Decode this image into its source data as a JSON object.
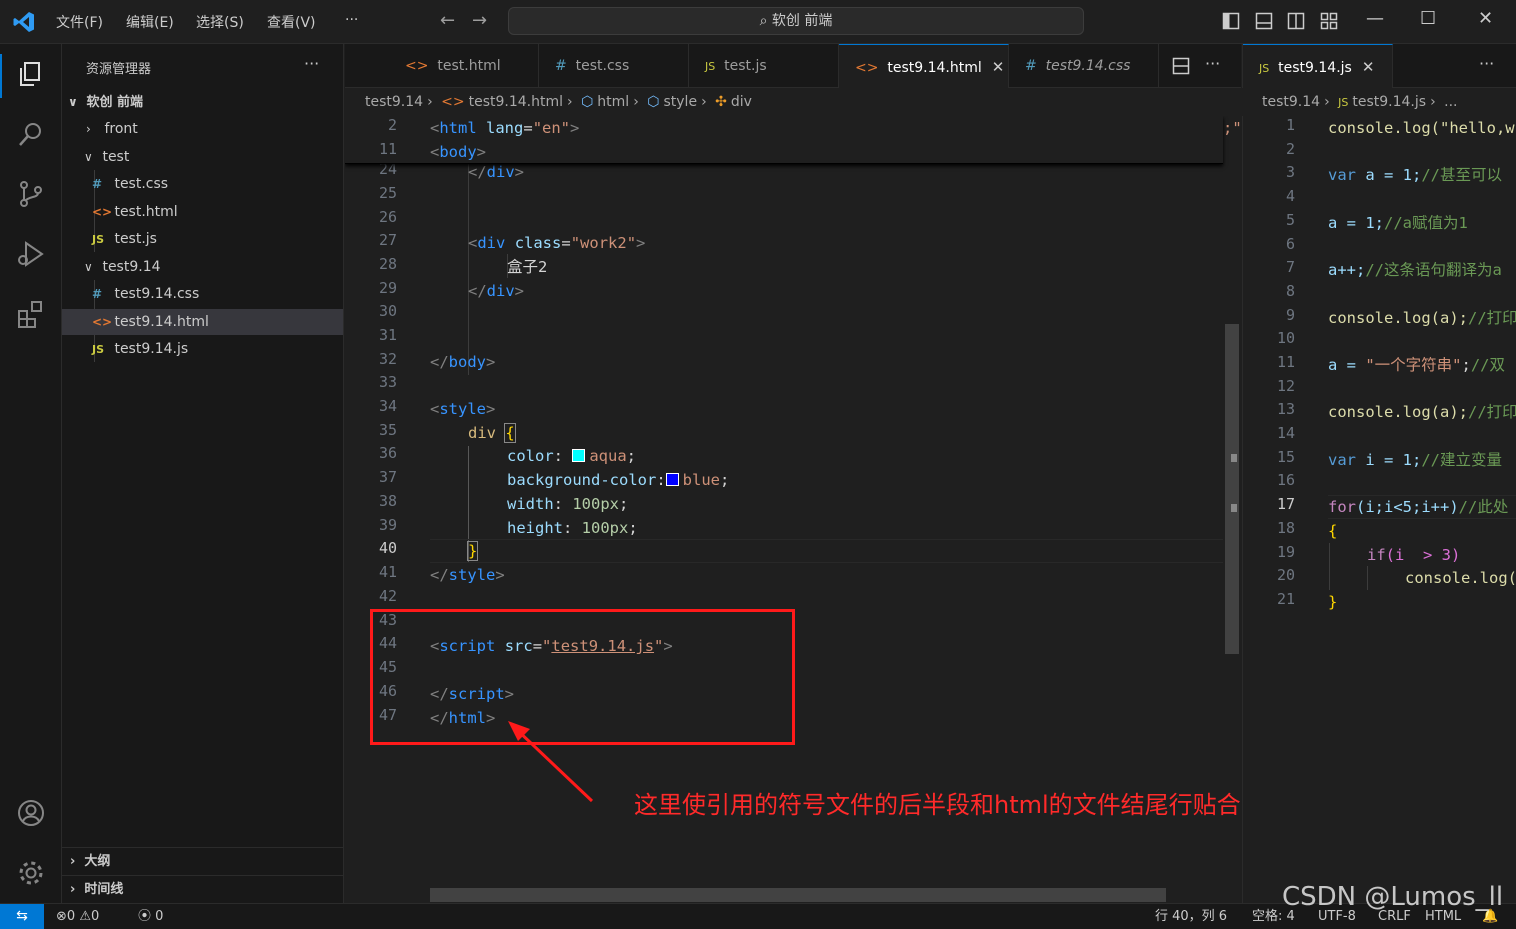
{
  "titlebar": {
    "menu": [
      "文件(F)",
      "编辑(E)",
      "选择(S)",
      "查看(V)",
      "···"
    ],
    "search": "软创 前端"
  },
  "sidebar": {
    "title": "资源管理器",
    "more": "···",
    "root": "软创 前端",
    "items": [
      {
        "label": "front",
        "type": "folder",
        "open": false
      },
      {
        "label": "test",
        "type": "folder",
        "open": true
      },
      {
        "label": "test.css",
        "type": "css"
      },
      {
        "label": "test.html",
        "type": "html"
      },
      {
        "label": "test.js",
        "type": "js"
      },
      {
        "label": "test9.14",
        "type": "folder",
        "open": true
      },
      {
        "label": "test9.14.css",
        "type": "css"
      },
      {
        "label": "test9.14.html",
        "type": "html"
      },
      {
        "label": "test9.14.js",
        "type": "js"
      }
    ],
    "outline": "大纲",
    "timeline": "时间线"
  },
  "editor1": {
    "tabs": [
      {
        "label": "test.html",
        "icon": "<>"
      },
      {
        "label": "test.css",
        "icon": "#"
      },
      {
        "label": "test.js",
        "icon": "JS"
      },
      {
        "label": "test9.14.html",
        "icon": "<>"
      },
      {
        "label": "test9.14.css",
        "icon": "#"
      }
    ],
    "breadcrumb": [
      "test9.14",
      "test9.14.html",
      "html",
      "style",
      "div"
    ],
    "lines": [
      "2",
      "11",
      "24",
      "25",
      "26",
      "27",
      "28",
      "29",
      "30",
      "31",
      "32",
      "33",
      "34",
      "35",
      "36",
      "37",
      "38",
      "39",
      "40",
      "41",
      "42",
      "43",
      "44",
      "45",
      "46",
      "47"
    ],
    "code": {
      "l2_tag": "html",
      "l2_attr": "lang",
      "l2_val": "\"en\"",
      "l11_tag": "body",
      "l24": "div",
      "l27_tag": "div",
      "l27_attr": "class",
      "l27_val": "\"work2\"",
      "l28": "盒子2",
      "l29": "div",
      "l32": "body",
      "l34": "style",
      "l35": "div",
      "l36_prop": "color",
      "l36_val": "aqua",
      "l37_prop": "background-color",
      "l37_val": "blue",
      "l38_prop": "width",
      "l38_val": "100px",
      "l39_prop": "height",
      "l39_val": "100px",
      "l41": "style",
      "l44_tag": "script",
      "l44_attr": "src",
      "l44_val": "test9.14.js",
      "l46": "script",
      "l47": "html",
      "overflow_mark": ";\""
    }
  },
  "editor2": {
    "tab": "test9.14.js",
    "breadcrumb": [
      "test9.14",
      "test9.14.js",
      "..."
    ],
    "lines": [
      "1",
      "2",
      "3",
      "4",
      "5",
      "6",
      "7",
      "8",
      "9",
      "10",
      "11",
      "12",
      "13",
      "14",
      "15",
      "16",
      "17",
      "18",
      "19",
      "20",
      "21"
    ],
    "code": {
      "l1": "console.log(\"hello,w",
      "l3_kw": "var",
      "l3_rest": " a = 1;",
      "l3_cmt": "//甚至可以",
      "l5_rest": "a = 1;",
      "l5_cmt": "//a赋值为1",
      "l7_rest": "a++;",
      "l7_cmt": "//这条语句翻译为a",
      "l9_rest": "console.log(a);",
      "l9_cmt": "//打印",
      "l11_rest": "a = ",
      "l11_str": "\"一个字符串\"",
      "l11_end": ";",
      "l11_cmt": "//双",
      "l13_rest": "console.log(a);",
      "l13_cmt": "//打印",
      "l15_kw": "var",
      "l15_rest": " i = 1;",
      "l15_cmt": "//建立变量",
      "l17_ctl": "for",
      "l17_rest": "(i;i<5;i++)",
      "l17_cmt": "//此处",
      "l18": "{",
      "l19_ctl": "if",
      "l19_rest": "(i  > 3)",
      "l20": "console.log(",
      "l21": "}"
    }
  },
  "statusbar": {
    "remote": "⇆",
    "errors": "0",
    "warnings": "0",
    "ports": "0",
    "position": "行 40，列 6",
    "spaces": "空格: 4",
    "encoding": "UTF-8",
    "eol": "CRLF",
    "language": "HTML"
  },
  "annotation": {
    "text": "这里使引用的符号文件的后半段和html的文件结尾行贴合",
    "color": "#ff2a2a"
  },
  "watermark": "CSDN @Lumos_ll",
  "colors": {
    "accent": "#0078d4",
    "annotation": "#ff1a1a"
  }
}
